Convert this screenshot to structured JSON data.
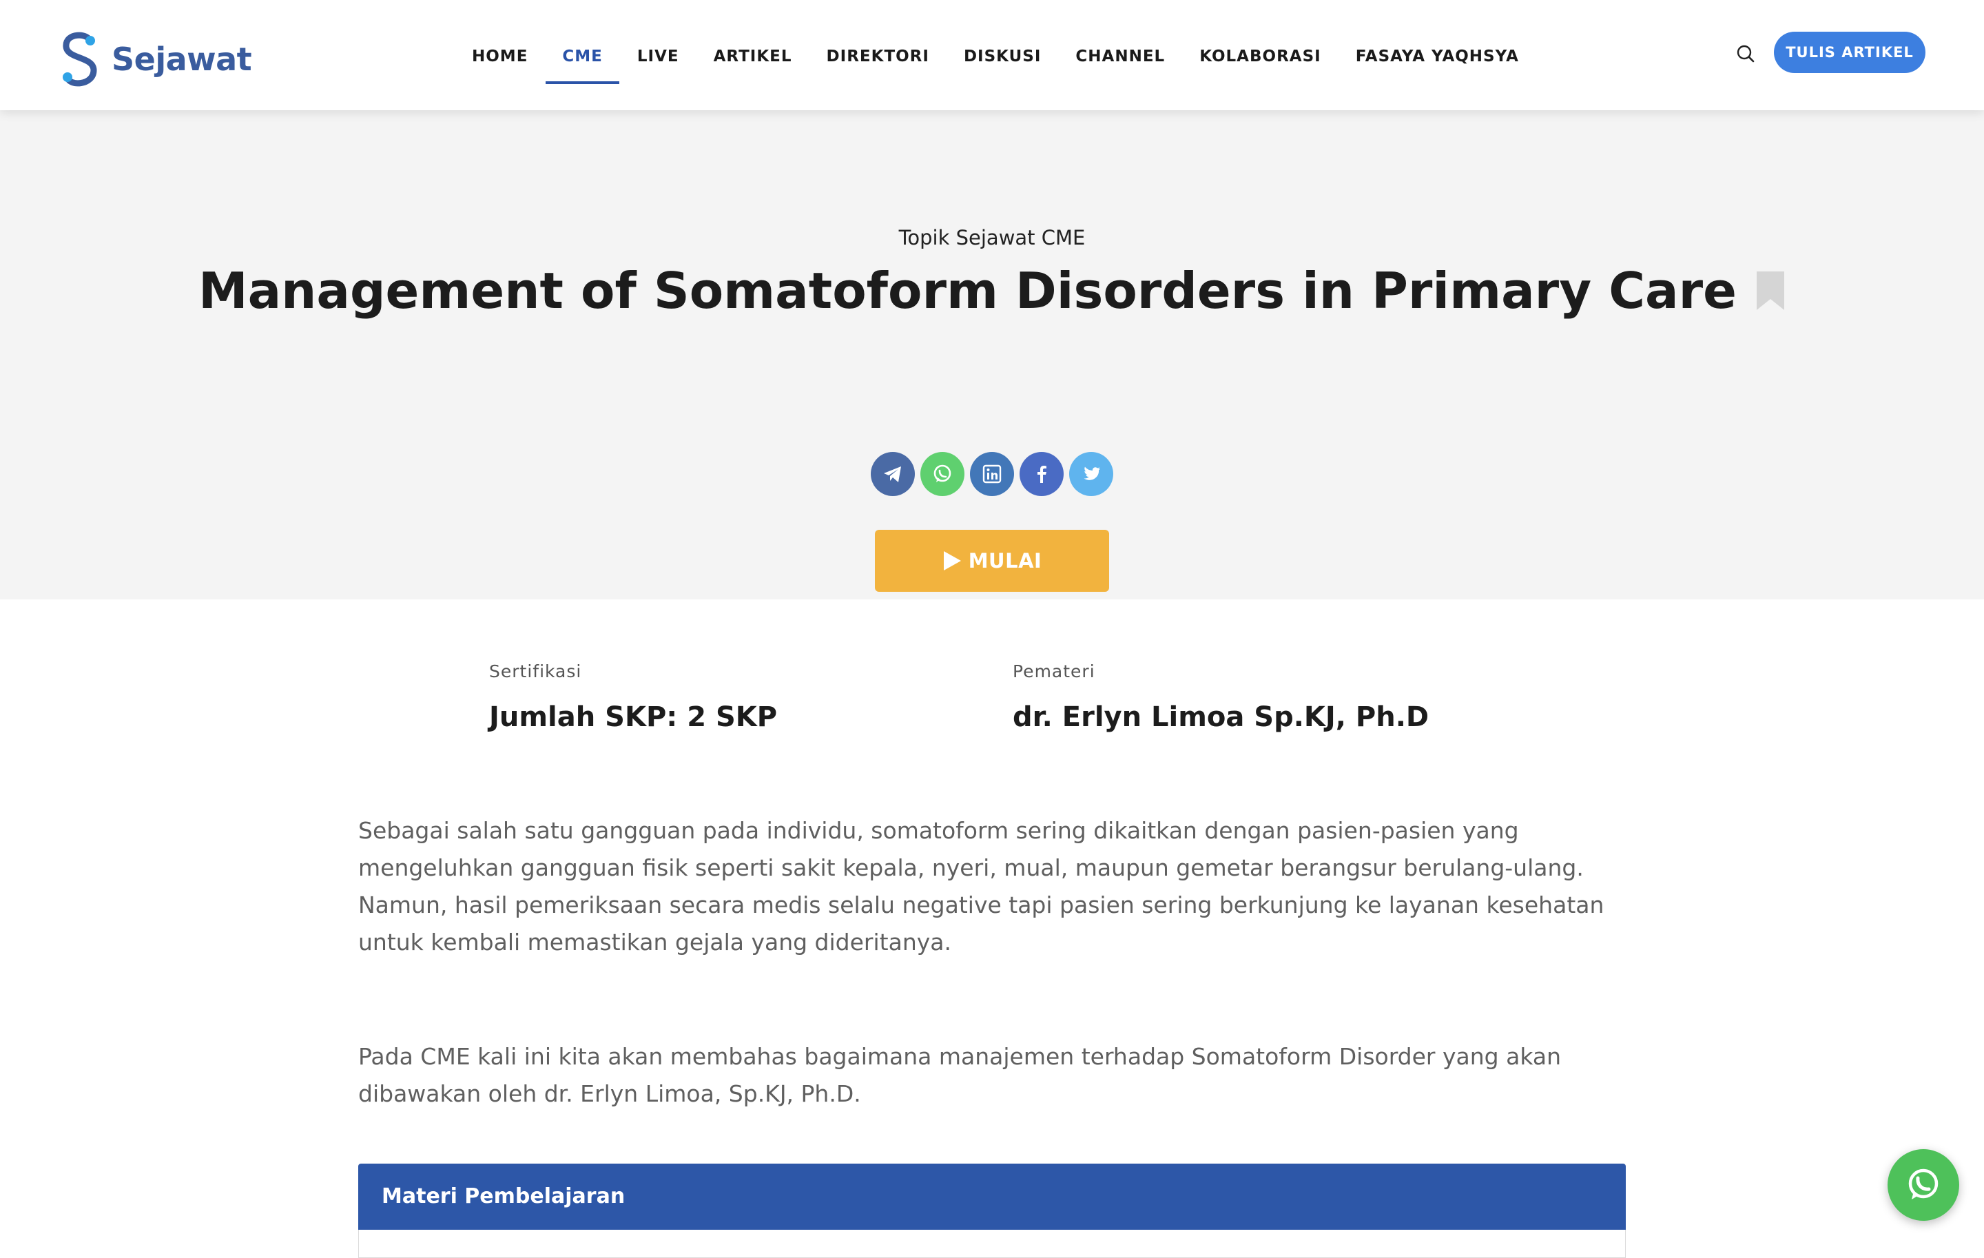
{
  "brand": {
    "name": "Sejawat",
    "color": "#3a5c9e",
    "accent": "#2fa3e6"
  },
  "nav": {
    "items": [
      {
        "label": "HOME",
        "active": false
      },
      {
        "label": "CME",
        "active": true
      },
      {
        "label": "LIVE",
        "active": false
      },
      {
        "label": "ARTIKEL",
        "active": false
      },
      {
        "label": "DIREKTORI",
        "active": false
      },
      {
        "label": "DISKUSI",
        "active": false
      },
      {
        "label": "CHANNEL",
        "active": false
      },
      {
        "label": "KOLABORASI",
        "active": false
      },
      {
        "label": "FASAYA YAQHSYA",
        "active": false
      }
    ],
    "active_color": "#2a53a8",
    "search_icon": "search-icon",
    "write_button": "TULIS ARTIKEL",
    "write_button_color": "#3d7fe0"
  },
  "hero": {
    "topic": "Topik Sejawat CME",
    "title": "Management of Somatoform Disorders in Primary Care",
    "bookmark_icon": "bookmark-icon",
    "share": [
      {
        "icon": "telegram-icon",
        "color": "#4a6aa5"
      },
      {
        "icon": "whatsapp-icon",
        "color": "#5fd06f"
      },
      {
        "icon": "linkedin-icon",
        "color": "#4277b8"
      },
      {
        "icon": "facebook-icon",
        "color": "#4a6bc4"
      },
      {
        "icon": "twitter-icon",
        "color": "#5fb4ee"
      }
    ],
    "start_button": "MULAI",
    "start_button_color": "#f2b33e"
  },
  "info": {
    "certification_label": "Sertifikasi",
    "certification_value": "Jumlah SKP: 2 SKP",
    "speaker_label": "Pemateri",
    "speaker_value": "dr. Erlyn Limoa Sp.KJ, Ph.D"
  },
  "description": {
    "p1": "Sebagai salah satu gangguan pada individu, somatoform sering dikaitkan dengan pasien-pasien yang mengeluhkan gangguan fisik seperti sakit kepala, nyeri, mual, maupun gemetar berangsur berulang-ulang. Namun, hasil pemeriksaan secara medis selalu negative tapi pasien sering berkunjung ke layanan kesehatan untuk kembali memastikan gejala yang dideritanya.",
    "p2": "Pada CME kali ini kita akan membahas bagaimana manajemen terhadap Somatoform Disorder yang akan dibawakan oleh dr. Erlyn Limoa, Sp.KJ, Ph.D."
  },
  "materi": {
    "title": "Materi Pembelajaran",
    "color": "#2d57a8"
  },
  "floating": {
    "icon": "whatsapp-icon",
    "color": "#4ec15a"
  }
}
